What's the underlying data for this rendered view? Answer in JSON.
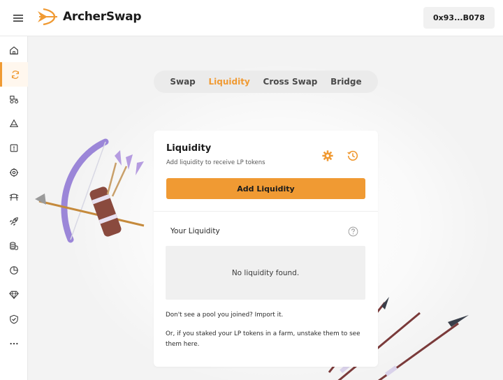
{
  "header": {
    "logo_text": "ArcherSwap",
    "wallet_label": "0x93...B078"
  },
  "sidebar": {
    "items": [
      {
        "icon": "home-icon"
      },
      {
        "icon": "swap-icon",
        "active": true
      },
      {
        "icon": "farm-icon"
      },
      {
        "icon": "pool-icon"
      },
      {
        "icon": "info-icon"
      },
      {
        "icon": "target-icon"
      },
      {
        "icon": "bridge-icon"
      },
      {
        "icon": "rocket-icon"
      },
      {
        "icon": "coins-icon"
      },
      {
        "icon": "chart-pie-icon"
      },
      {
        "icon": "gem-icon"
      },
      {
        "icon": "shield-check-icon"
      },
      {
        "icon": "more-icon"
      }
    ]
  },
  "tabs": [
    {
      "label": "Swap"
    },
    {
      "label": "Liquidity",
      "active": true
    },
    {
      "label": "Cross Swap"
    },
    {
      "label": "Bridge"
    }
  ],
  "card": {
    "title": "Liquidity",
    "subtitle": "Add liquidity to receive LP tokens",
    "add_button": "Add Liquidity",
    "your_liquidity": "Your Liquidity",
    "empty_text": "No liquidity found.",
    "import_text": "Don't see a pool you joined? Import it.",
    "note_text": "Or, if you staked your LP tokens in a farm, unstake them to see them here."
  },
  "colors": {
    "accent": "#f09a33",
    "bow": "#9b86d8",
    "quiver": "#8a4a3e"
  }
}
